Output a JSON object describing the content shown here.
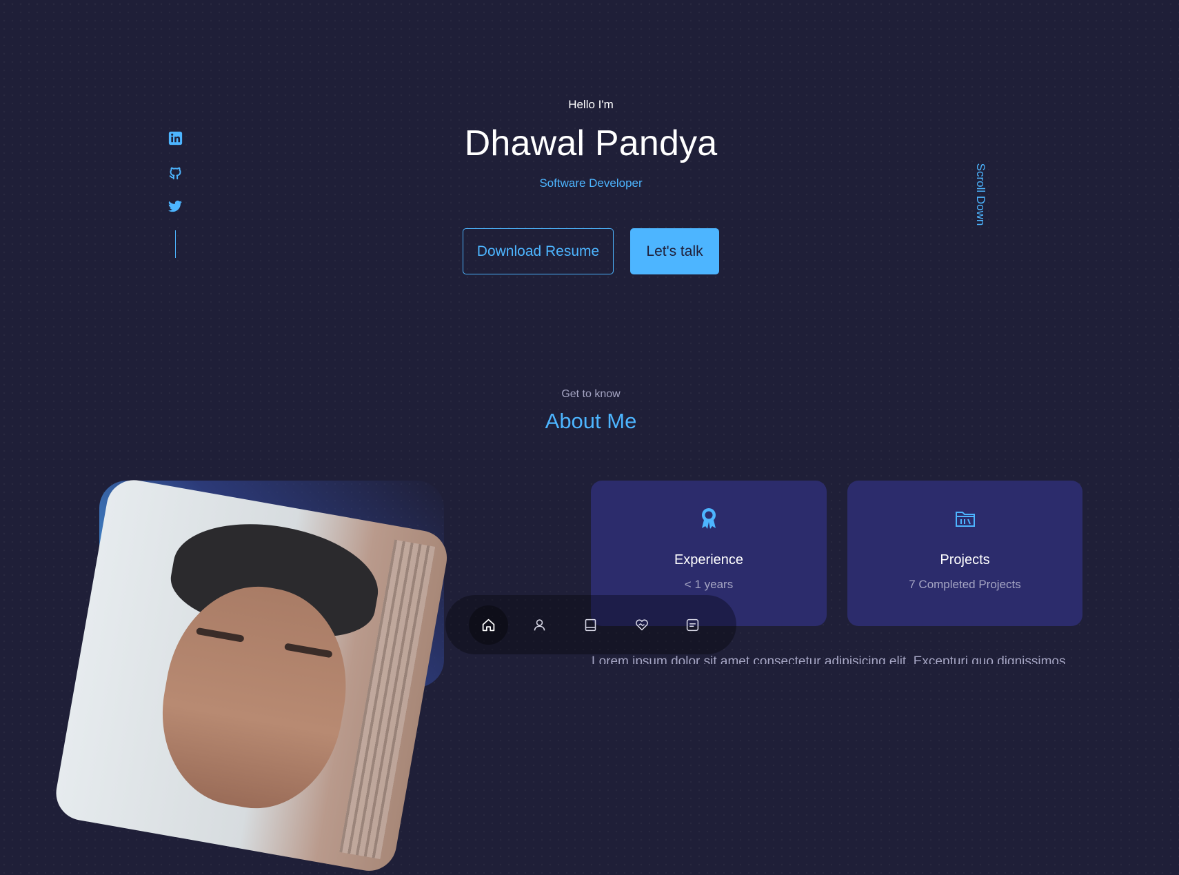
{
  "hero": {
    "greeting": "Hello I'm",
    "name": "Dhawal Pandya",
    "role": "Software Developer",
    "download_label": "Download Resume",
    "talk_label": "Let's talk",
    "scroll_label": "Scroll Down"
  },
  "socials": [
    {
      "icon": "linkedin-icon"
    },
    {
      "icon": "github-icon"
    },
    {
      "icon": "twitter-icon"
    }
  ],
  "about": {
    "subtitle": "Get to know",
    "title": "About Me",
    "cards": [
      {
        "icon": "award-icon",
        "title": "Experience",
        "text": "< 1 years"
      },
      {
        "icon": "folder-icon",
        "title": "Projects",
        "text": "7 Completed Projects"
      }
    ],
    "paragraph_partial": "Lorem ipsum dolor sit amet consectetur adipisicing elit. Excepturi quo dignissimos"
  },
  "bottom_nav": [
    {
      "icon": "home-icon",
      "active": true
    },
    {
      "icon": "user-icon",
      "active": false
    },
    {
      "icon": "book-icon",
      "active": false
    },
    {
      "icon": "services-icon",
      "active": false
    },
    {
      "icon": "message-icon",
      "active": false
    }
  ],
  "colors": {
    "background": "#1f1f38",
    "primary": "#4db5ff",
    "card": "#2c2c6c",
    "text_light": "#a6a6c4"
  }
}
